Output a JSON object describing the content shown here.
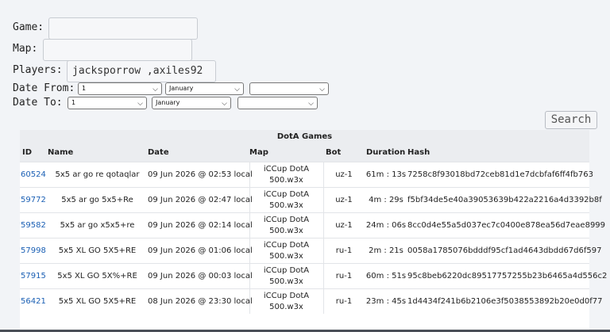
{
  "form": {
    "game_label": "Game:",
    "game_value": "",
    "map_label": "Map:",
    "map_value": "",
    "players_label": "Players:",
    "players_value": "jacksporrow ,axiles92",
    "date_from_label": "Date From:",
    "date_to_label": "Date To:",
    "from_day": "1",
    "from_month": "January",
    "from_year": "",
    "to_day": "1",
    "to_month": "January",
    "to_year": "",
    "search_label": "Search"
  },
  "table": {
    "caption": "DotA Games",
    "headers": [
      "ID",
      "Name",
      "Date",
      "Map",
      "Bot",
      "Duration",
      "Hash"
    ],
    "rows": [
      {
        "id": "60524",
        "name": "5x5 ar go re qotaqlar",
        "date": "09 Jun 2026 @ 02:53 local",
        "map1": "iCCup DotA",
        "map2": "500.w3x",
        "bot": "uz-1",
        "duration": "61m : 13s",
        "hash": "7258c8f93018bd72ceb81d1e7dcbfaf6ff4fb763"
      },
      {
        "id": "59772",
        "name": "5x5 ar go 5x5+Re",
        "date": "09 Jun 2026 @ 02:47 local",
        "map1": "iCCup DotA",
        "map2": "500.w3x",
        "bot": "uz-1",
        "duration": "4m : 29s",
        "hash": "f5bf34de5e40a39053639b422a2216a4d3392b8f"
      },
      {
        "id": "59582",
        "name": "5x5 ar go x5x5+re",
        "date": "09 Jun 2026 @ 02:14 local",
        "map1": "iCCup DotA",
        "map2": "500.w3x",
        "bot": "uz-1",
        "duration": "24m : 06s",
        "hash": "8cc0d4e55a5d037ec7c0400e878ea56d7eae8999"
      },
      {
        "id": "57998",
        "name": "5x5 XL GO 5X5+RE",
        "date": "09 Jun 2026 @ 01:06 local",
        "map1": "iCCup DotA",
        "map2": "500.w3x",
        "bot": "ru-1",
        "duration": "2m : 21s",
        "hash": "0058a1785076bdddf95cf1ad4643dbdd67d6f597"
      },
      {
        "id": "57915",
        "name": "5x5 XL GO 5X%+RE",
        "date": "09 Jun 2026 @ 00:03 local",
        "map1": "iCCup DotA",
        "map2": "500.w3x",
        "bot": "ru-1",
        "duration": "60m : 51s",
        "hash": "95c8beb6220dc89517757255b23b6465a4d556c2"
      },
      {
        "id": "56421",
        "name": "5x5 XL GO 5X5+RE",
        "date": "08 Jun 2026 @ 23:30 local",
        "map1": "iCCup DotA",
        "map2": "500.w3x",
        "bot": "ru-1",
        "duration": "23m : 45s",
        "hash": "1d4434f241b6b2106e3f5038553892b20e0d0f77"
      }
    ]
  },
  "colors": {
    "link": "#1a5fb4",
    "header_bg": "#ebedf0",
    "page_bg": "#f2f4f7"
  }
}
